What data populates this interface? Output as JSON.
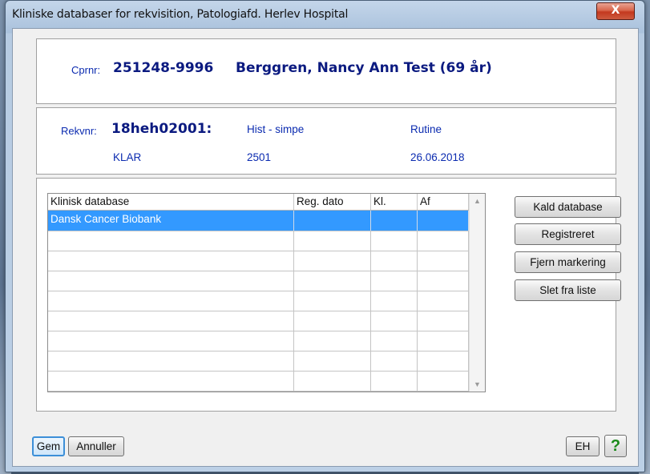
{
  "window": {
    "title": "Kliniske databaser for rekvisition,  Patologiafd. Herlev Hospital",
    "close_label": "X"
  },
  "patient": {
    "cprnr_label": "Cprnr:",
    "cprnr": "251248-9996",
    "name": "Berggren, Nancy Ann Test (69 år)"
  },
  "requisition": {
    "rekvnr_label": "Rekvnr:",
    "rekvnr": "18heh02001:",
    "type": "Hist - simpe",
    "priority": "Rutine",
    "status": "KLAR",
    "code": "2501",
    "date": "26.06.2018"
  },
  "grid": {
    "columns": [
      "Klinisk database",
      "Reg. dato",
      "Kl.",
      "Af"
    ],
    "rows": [
      [
        "Dansk Cancer Biobank",
        "",
        "",
        ""
      ],
      [
        "",
        "",
        "",
        ""
      ],
      [
        "",
        "",
        "",
        ""
      ],
      [
        "",
        "",
        "",
        ""
      ],
      [
        "",
        "",
        "",
        ""
      ],
      [
        "",
        "",
        "",
        ""
      ],
      [
        "",
        "",
        "",
        ""
      ],
      [
        "",
        "",
        "",
        ""
      ],
      [
        "",
        "",
        "",
        ""
      ]
    ]
  },
  "actions": {
    "call_db": "Kald database",
    "registered": "Registreret",
    "remove_mark": "Fjern markering",
    "delete": "Slet fra liste"
  },
  "footer": {
    "save": "Gem",
    "cancel": "Annuller",
    "eh": "EH",
    "help": "?"
  }
}
